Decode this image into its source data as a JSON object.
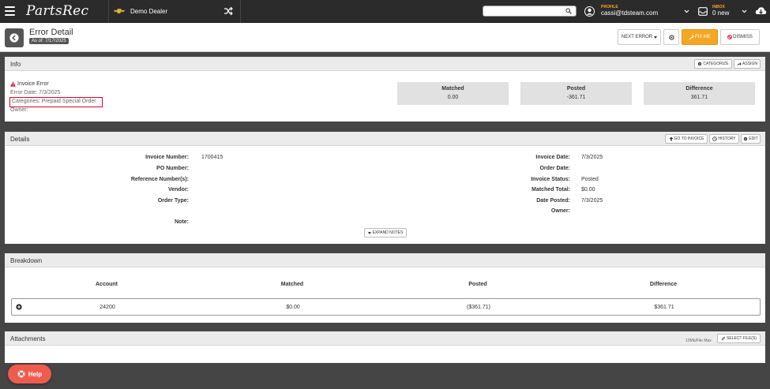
{
  "app": {
    "brand": "PartsRec",
    "dealer": "Demo Dealer",
    "search": {
      "value": "",
      "placeholder": ""
    },
    "profile": {
      "label": "PROFILE",
      "email": "cassi@tdsteam.com"
    },
    "inbox": {
      "label": "INBOX",
      "count": "0 new"
    }
  },
  "header": {
    "title": "Error Detail",
    "as_of": "As of: 7/17/2025",
    "buttons": {
      "next_error": "NEXT ERROR",
      "fix_me": "FIX ME",
      "dismiss": "DISMISS"
    }
  },
  "info": {
    "title": "Info",
    "buttons": {
      "categorize": "CATEGORIZE",
      "assign": "ASSIGN"
    },
    "error_type": "Invoice Error",
    "error_date": "Error Date: 7/3/2025",
    "categories": "Categories: Prepaid Special Order",
    "owner": "Owner:",
    "stats": [
      {
        "label": "Matched",
        "value": "0.00"
      },
      {
        "label": "Posted",
        "value": "-361.71"
      },
      {
        "label": "Difference",
        "value": "361.71"
      }
    ]
  },
  "details": {
    "title": "Details",
    "buttons": {
      "go_to_invoice": "GO TO INVOICE",
      "history": "HISTORY",
      "edit": "EDIT"
    },
    "left": [
      {
        "label": "Invoice Number:",
        "value": "1700415"
      },
      {
        "label": "PO Number:",
        "value": ""
      },
      {
        "label": "Reference Number(s):",
        "value": ""
      },
      {
        "label": "Vendor:",
        "value": ""
      },
      {
        "label": "Order Type:",
        "value": ""
      }
    ],
    "note_label": "Note:",
    "right": [
      {
        "label": "Invoice Date:",
        "value": "7/3/2025"
      },
      {
        "label": "Order Date:",
        "value": ""
      },
      {
        "label": "Invoice Status:",
        "value": "Posted"
      },
      {
        "label": "Matched Total:",
        "value": "$0.00"
      },
      {
        "label": "Date Posted:",
        "value": "7/3/2025"
      },
      {
        "label": "Owner:",
        "value": ""
      }
    ],
    "expand_notes": "EXPAND NOTES"
  },
  "breakdown": {
    "title": "Breakdown",
    "columns": [
      "Account",
      "Matched",
      "Posted",
      "Difference"
    ],
    "rows": [
      {
        "account": "24200",
        "matched": "$0.00",
        "posted": "($361.71)",
        "difference": "$361.71"
      }
    ]
  },
  "attachments": {
    "title": "Attachments",
    "max_note": "10Mb/File Max",
    "select_files": "SELECT FILE(S)"
  },
  "help": {
    "label": "Help"
  },
  "colors": {
    "accent": "#f5a623",
    "danger": "#e0002a",
    "help": "#ee5c4e",
    "navbar": "#2b2b2b"
  }
}
